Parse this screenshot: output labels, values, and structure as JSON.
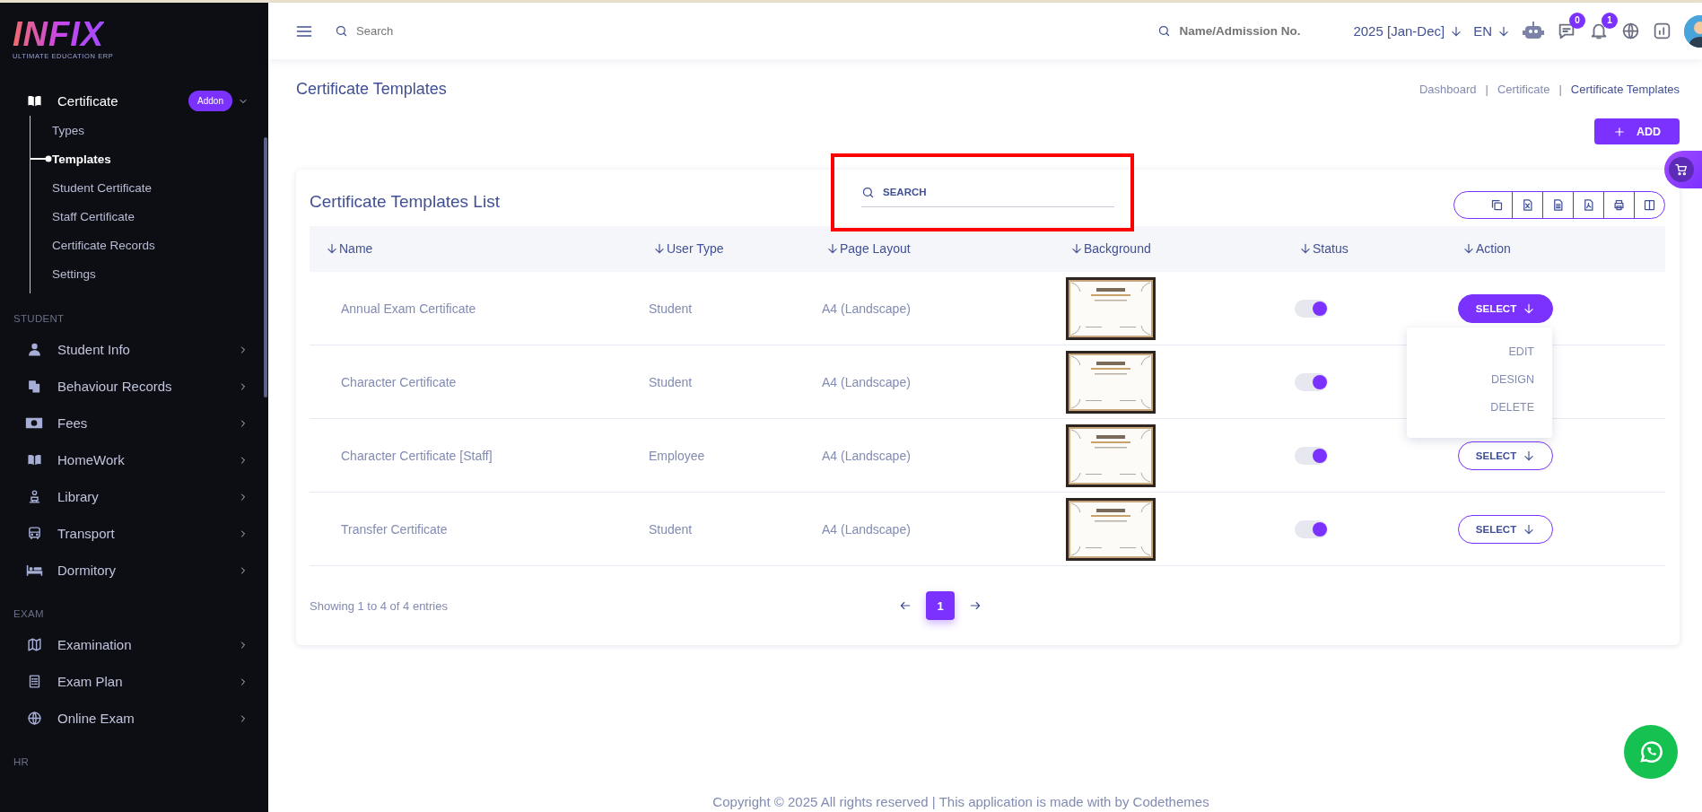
{
  "logo": {
    "name": "INFIX",
    "tagline": "ULTIMATE EDUCATION ERP"
  },
  "sidebar": {
    "items": [
      {
        "kind": "item",
        "label": "Certificate",
        "badge": "Addon",
        "expanded": true,
        "children": [
          {
            "label": "Types",
            "selected": false
          },
          {
            "label": "Templates",
            "selected": true
          },
          {
            "label": "Student Certificate",
            "selected": false
          },
          {
            "label": "Staff Certificate",
            "selected": false
          },
          {
            "label": "Certificate Records",
            "selected": false
          },
          {
            "label": "Settings",
            "selected": false
          }
        ]
      },
      {
        "kind": "section",
        "label": "STUDENT"
      },
      {
        "kind": "item",
        "label": "Student Info",
        "expanded": false
      },
      {
        "kind": "item",
        "label": "Behaviour Records",
        "expanded": false
      },
      {
        "kind": "item",
        "label": "Fees",
        "expanded": false
      },
      {
        "kind": "item",
        "label": "HomeWork",
        "expanded": false
      },
      {
        "kind": "item",
        "label": "Library",
        "expanded": false
      },
      {
        "kind": "item",
        "label": "Transport",
        "expanded": false
      },
      {
        "kind": "item",
        "label": "Dormitory",
        "expanded": false
      },
      {
        "kind": "section",
        "label": "EXAM"
      },
      {
        "kind": "item",
        "label": "Examination",
        "expanded": false
      },
      {
        "kind": "item",
        "label": "Exam Plan",
        "expanded": false
      },
      {
        "kind": "item",
        "label": "Online Exam",
        "expanded": false
      },
      {
        "kind": "section",
        "label": "HR"
      }
    ]
  },
  "header": {
    "search": {
      "placeholder": "Search"
    },
    "student_search": {
      "placeholder": "Name/Admission No."
    },
    "session": "2025 [Jan-Dec]",
    "language": "EN",
    "message_count": "0",
    "notification_count": "1"
  },
  "page": {
    "title": "Certificate Templates",
    "breadcrumb": [
      "Dashboard",
      "Certificate",
      "Certificate Templates"
    ],
    "breadcrumb_separator": "|",
    "add_button": "ADD"
  },
  "card": {
    "title": "Certificate Templates List",
    "search": {
      "placeholder": "SEARCH",
      "highlighted": true
    },
    "columns": [
      "Name",
      "User Type",
      "Page Layout",
      "Background",
      "Status",
      "Action"
    ],
    "rows": [
      {
        "name": "Annual Exam Certificate",
        "user_type": "Student",
        "page_layout": "A4 (Landscape)",
        "on": true,
        "action": "SELECT",
        "menu_open": true
      },
      {
        "name": "Character Certificate",
        "user_type": "Student",
        "page_layout": "A4 (Landscape)",
        "on": true,
        "menu_open": false
      },
      {
        "name": "Character Certificate [Staff]",
        "user_type": "Employee",
        "page_layout": "A4 (Landscape)",
        "on": true,
        "action": "SELECT",
        "menu_open": false
      },
      {
        "name": "Transfer Certificate",
        "user_type": "Student",
        "page_layout": "A4 (Landscape)",
        "on": true,
        "action": "SELECT",
        "menu_open": false
      }
    ],
    "menu": [
      "EDIT",
      "DESIGN",
      "DELETE"
    ],
    "summary": "Showing 1 to 4 of 4 entries",
    "pages": [
      {
        "label": "1",
        "selected": true
      }
    ]
  },
  "footer": "Copyright © 2025 All rights reserved | This application is made with by Codethemes"
}
